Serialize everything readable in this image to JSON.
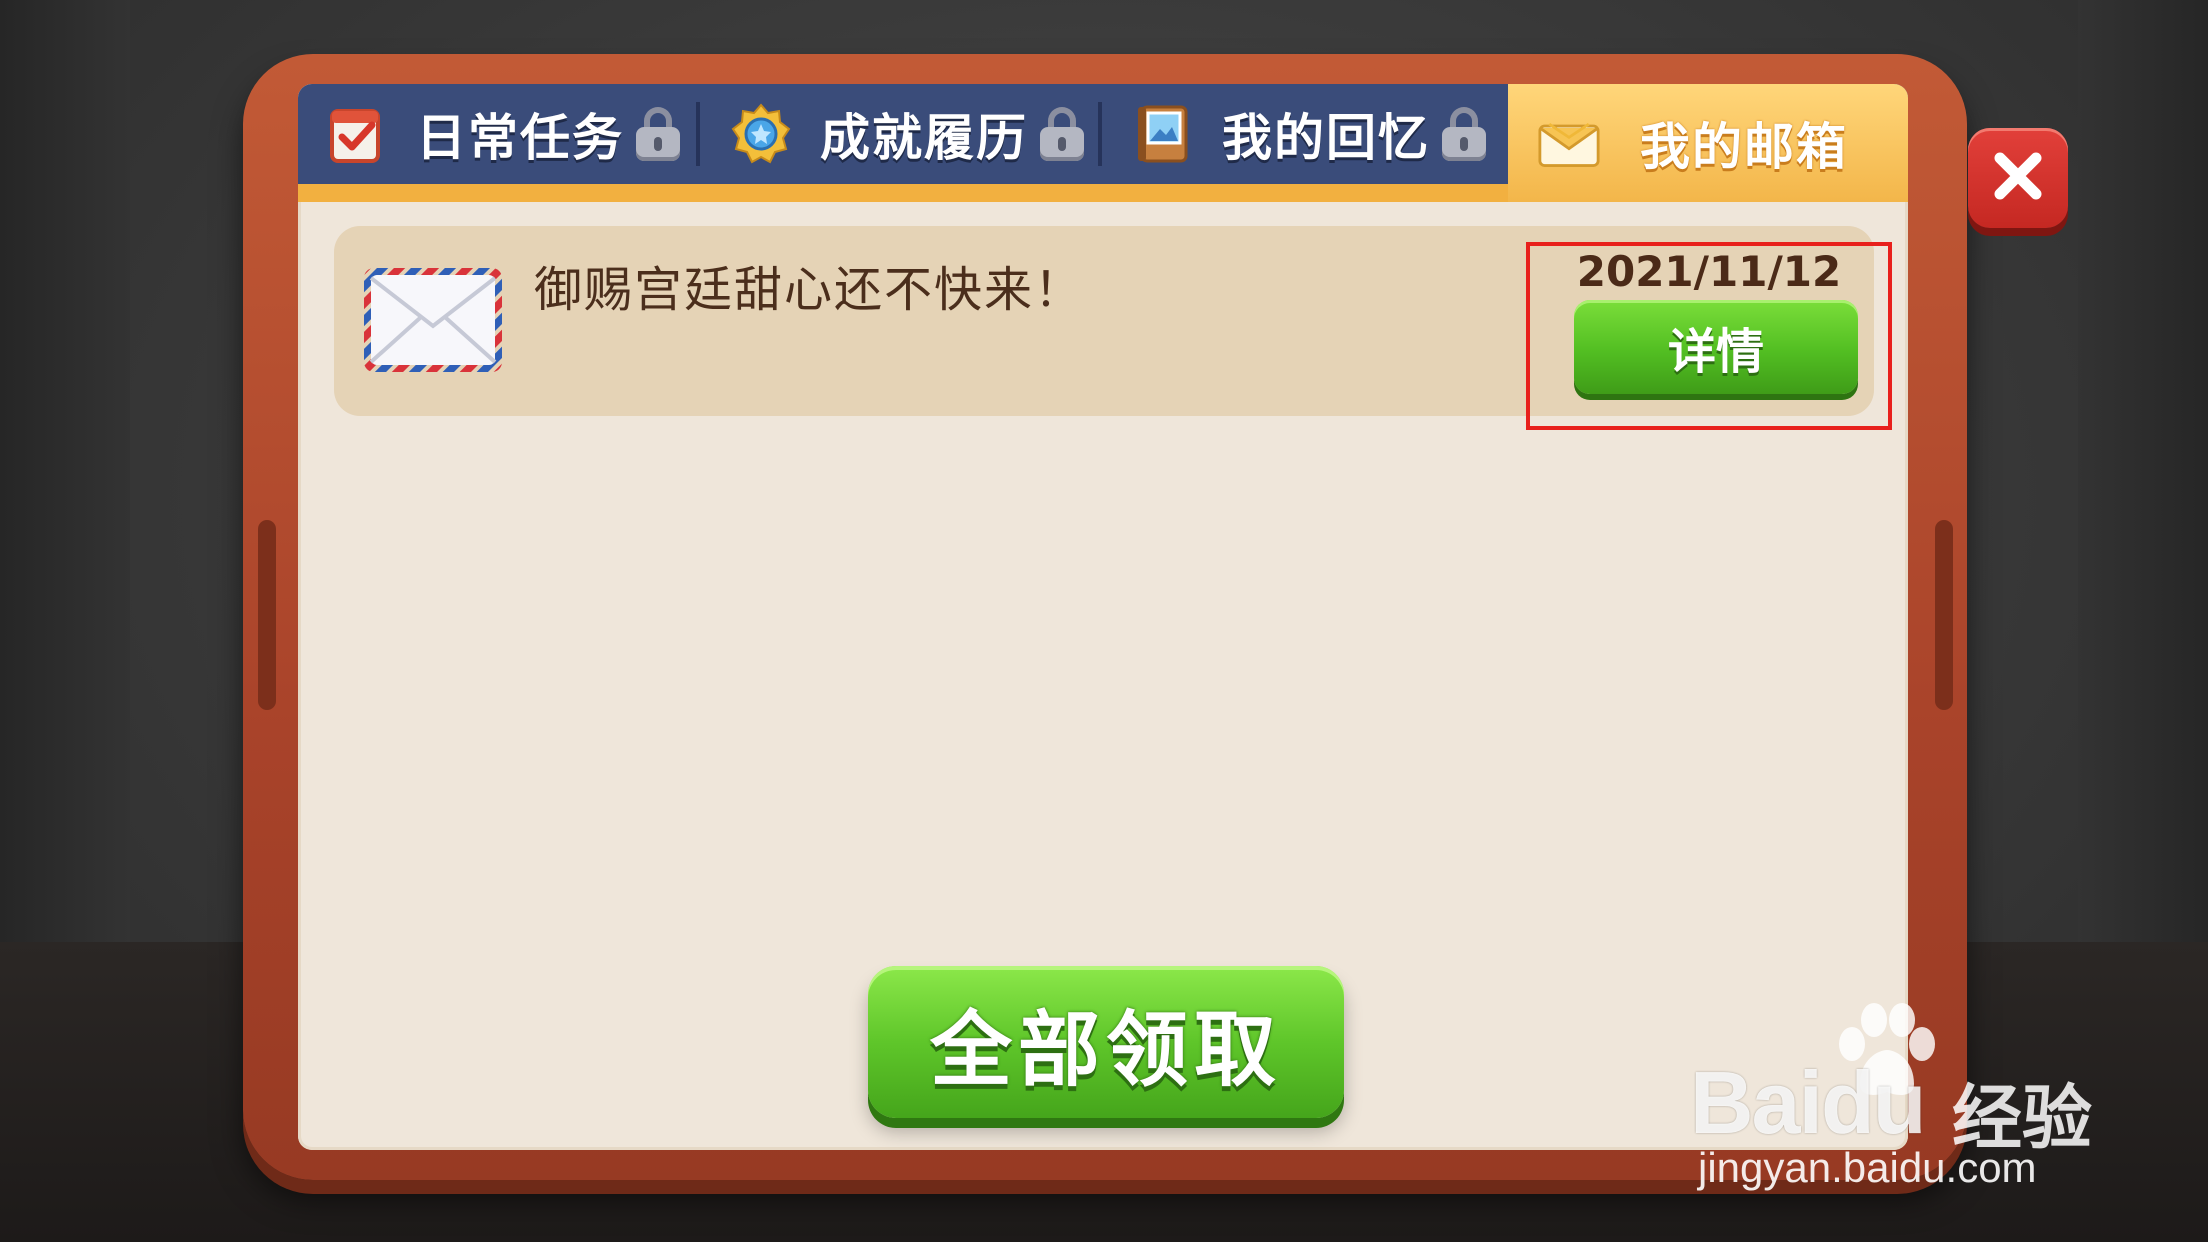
{
  "tabs": [
    {
      "label": "日常任务",
      "icon": "checklist-icon",
      "locked": true
    },
    {
      "label": "成就履历",
      "icon": "medal-icon",
      "locked": true
    },
    {
      "label": "我的回忆",
      "icon": "photo-album-icon",
      "locked": true
    },
    {
      "label": "我的邮箱",
      "icon": "mail-icon",
      "locked": false,
      "active": true
    }
  ],
  "mail": {
    "title": "御赐宫廷甜心还不快来！",
    "date": "2021/11/12",
    "detail_label": "详情",
    "icon": "envelope-icon"
  },
  "claim_all_label": "全部领取",
  "close_icon": "close-icon",
  "watermark": {
    "brand": "Baidu",
    "suffix": "经验",
    "url": "jingyan.baidu.com"
  },
  "colors": {
    "board": "#b04a2e",
    "panel": "#efe6da",
    "tabbar": "#3a4c7a",
    "tab_accent": "#f2b040",
    "button_green": "#52be22",
    "close_red": "#d0302a",
    "highlight": "#e8201c"
  }
}
